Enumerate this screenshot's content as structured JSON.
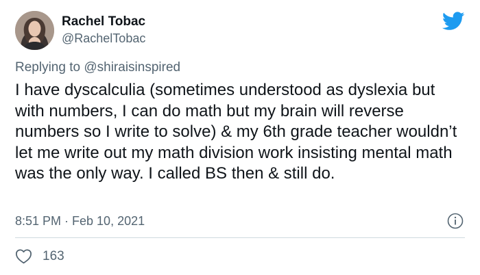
{
  "author": {
    "name": "Rachel Tobac",
    "handle": "@RachelTobac",
    "avatar_icon": "profile-photo"
  },
  "reply": {
    "prefix": "Replying to ",
    "mention": "@shiraisinspired"
  },
  "tweet": {
    "text": "I have dyscalculia (sometimes understood as dyslexia but with numbers, I can do math but my brain will reverse numbers so I write to solve) & my 6th grade teacher wouldn’t let me write out my math division work insisting mental math was the only way. I called BS then & still do.",
    "timestamp": "8:51 PM · Feb 10, 2021"
  },
  "stats": {
    "likes": "163"
  },
  "icons": {
    "logo": "twitter-bird-icon",
    "info": "info-icon",
    "like": "heart-icon"
  },
  "colors": {
    "brand": "#1d9bf0",
    "text": "#0f1419",
    "muted": "#536471",
    "divider": "#cfd9de"
  }
}
